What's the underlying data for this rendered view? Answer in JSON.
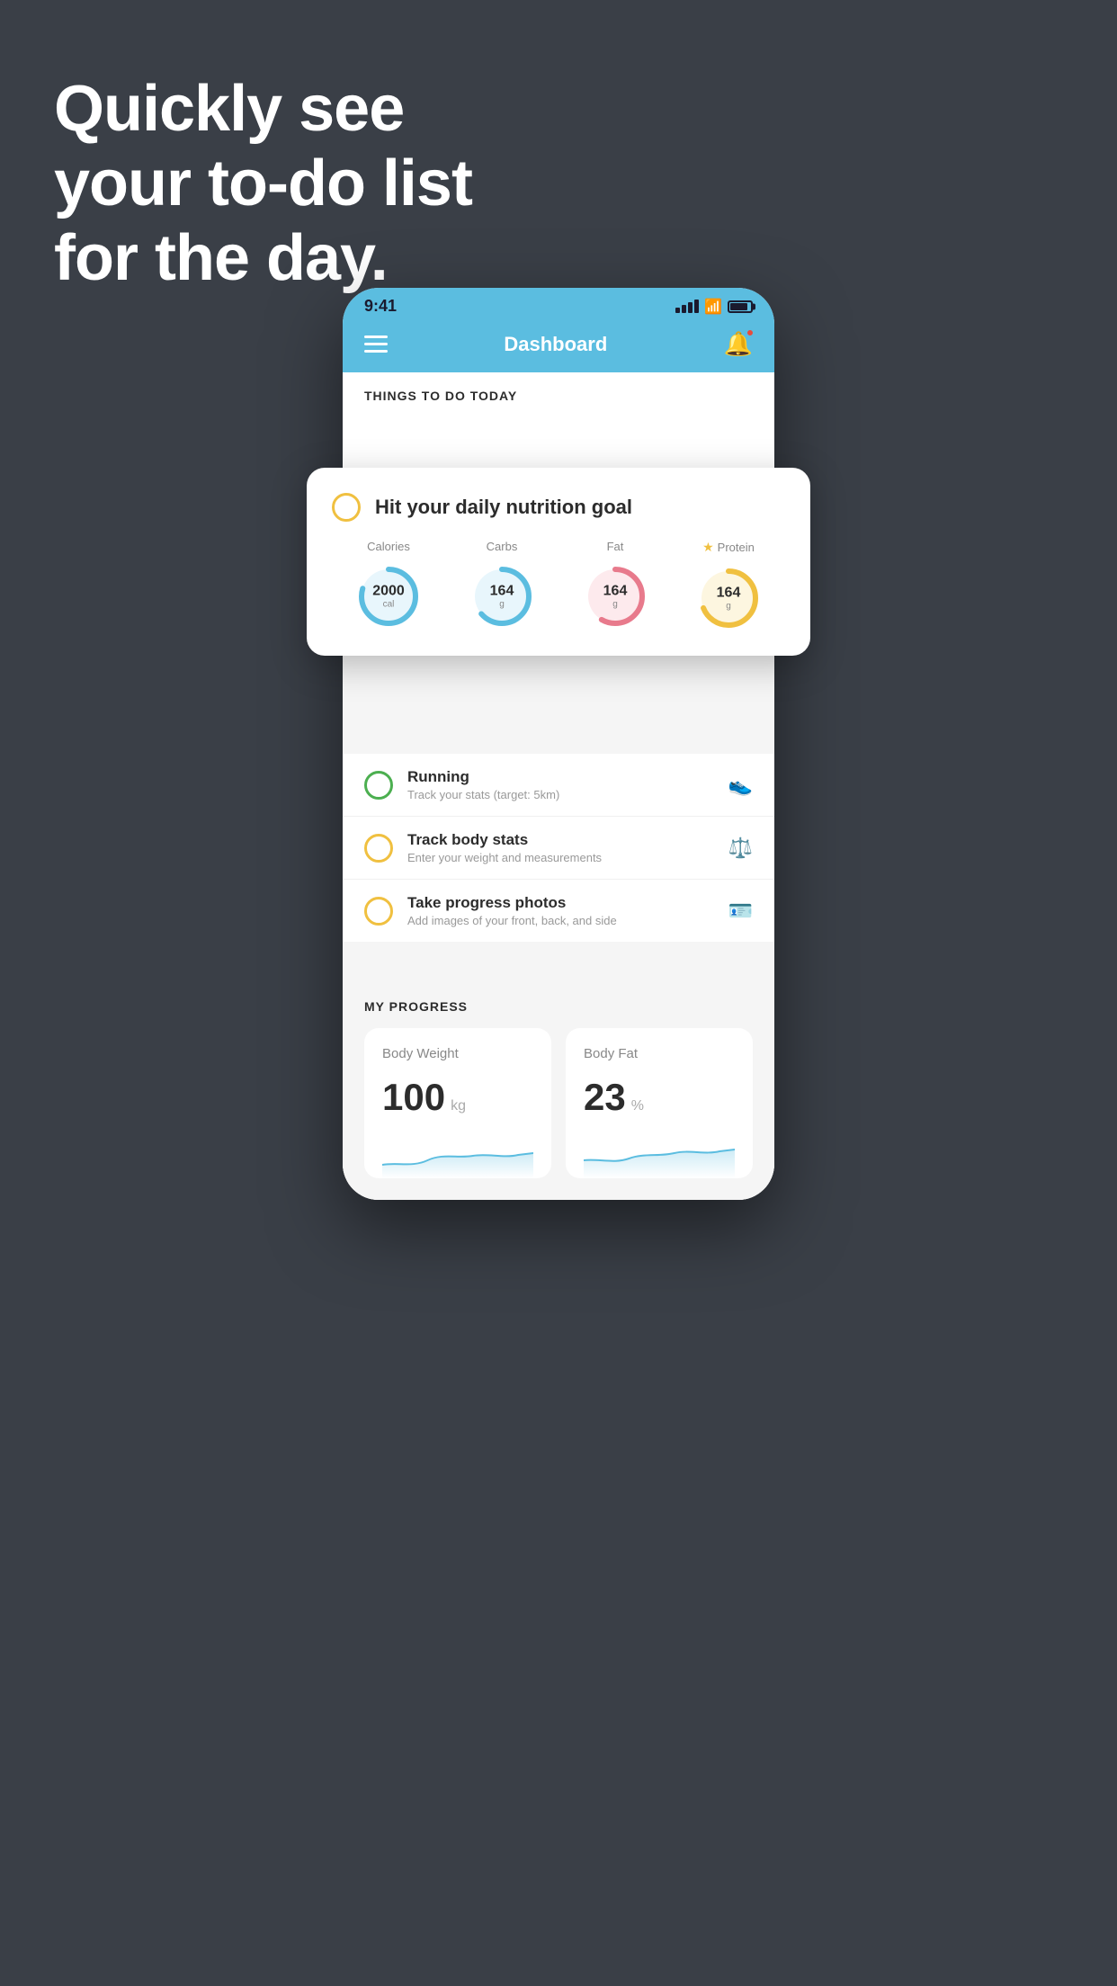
{
  "hero": {
    "line1": "Quickly see",
    "line2": "your to-do list",
    "line3": "for the day."
  },
  "statusBar": {
    "time": "9:41",
    "battery": "80"
  },
  "navbar": {
    "title": "Dashboard"
  },
  "sectionHeader": {
    "label": "THINGS TO DO TODAY"
  },
  "nutritionCard": {
    "title": "Hit your daily nutrition goal",
    "items": [
      {
        "label": "Calories",
        "value": "2000",
        "unit": "cal",
        "color": "#5bbde0",
        "bgColor": "#e8f6fc",
        "star": false
      },
      {
        "label": "Carbs",
        "value": "164",
        "unit": "g",
        "color": "#5bbde0",
        "bgColor": "#e8f6fc",
        "star": false
      },
      {
        "label": "Fat",
        "value": "164",
        "unit": "g",
        "color": "#e87a8c",
        "bgColor": "#fdeaed",
        "star": false
      },
      {
        "label": "Protein",
        "value": "164",
        "unit": "g",
        "color": "#f0c040",
        "bgColor": "#fdf6e0",
        "star": true
      }
    ]
  },
  "todoItems": [
    {
      "title": "Running",
      "subtitle": "Track your stats (target: 5km)",
      "circleColor": "green",
      "icon": "👟"
    },
    {
      "title": "Track body stats",
      "subtitle": "Enter your weight and measurements",
      "circleColor": "yellow",
      "icon": "⚖️"
    },
    {
      "title": "Take progress photos",
      "subtitle": "Add images of your front, back, and side",
      "circleColor": "yellow",
      "icon": "🪪"
    }
  ],
  "progressSection": {
    "header": "MY PROGRESS",
    "cards": [
      {
        "title": "Body Weight",
        "value": "100",
        "unit": "kg"
      },
      {
        "title": "Body Fat",
        "value": "23",
        "unit": "%"
      }
    ]
  }
}
